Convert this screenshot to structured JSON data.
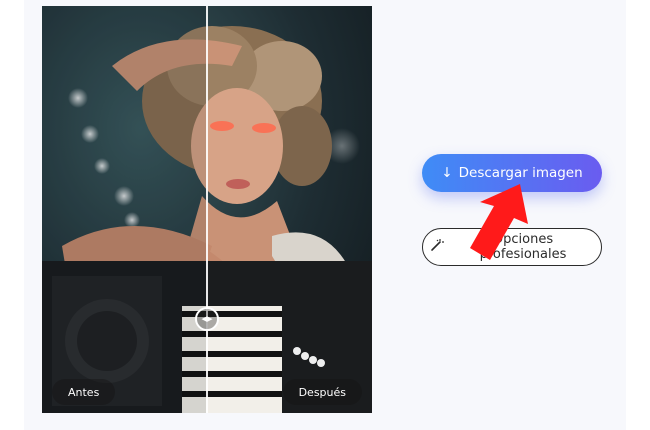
{
  "comparison": {
    "before_label": "Antes",
    "after_label": "Después"
  },
  "actions": {
    "download_label": "Descargar imagen",
    "professional_label": "Opciones profesionales"
  },
  "icons": {
    "download": "arrow-down-icon",
    "professional": "magic-wand-icon",
    "handle": "left-right-arrows-icon"
  },
  "colors": {
    "download_gradient_start": "#3f8cf6",
    "download_gradient_end": "#6a5cf0",
    "annotation_arrow": "#ff1a1a"
  }
}
